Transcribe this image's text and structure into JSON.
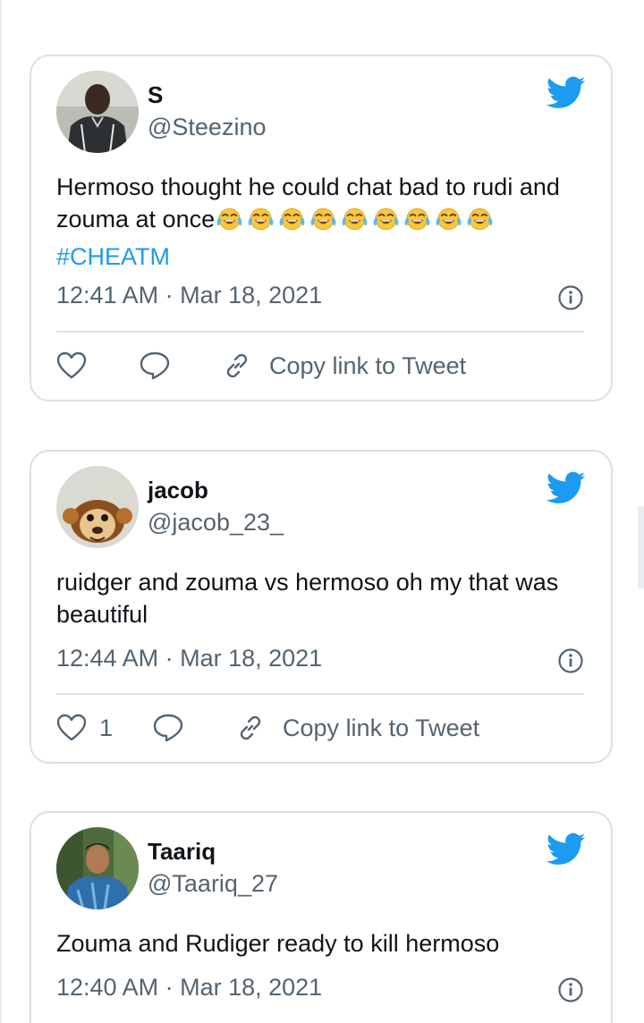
{
  "colors": {
    "brand_blue": "#1d9bf0",
    "text_primary": "#0f1419",
    "text_secondary": "#536471",
    "border": "#d9e1e7"
  },
  "icons": {
    "brand": "twitter-bird-icon",
    "info": "info-icon",
    "like": "heart-icon",
    "reply": "reply-bubble-icon",
    "copy": "link-icon",
    "emoji": "tears-of-joy-emoji"
  },
  "tweets": [
    {
      "name": "S",
      "handle": "@Steezino",
      "text_line1": "Hermoso thought he could chat bad to rudi and",
      "text_line2": "zouma at once",
      "emoji_count": 9,
      "hashtag": "#CHEATM",
      "timestamp": "12:41 AM · Mar 18, 2021",
      "like_count": "",
      "copy_label": "Copy link to Tweet"
    },
    {
      "name": "jacob",
      "handle": "@jacob_23_",
      "text": "ruidger and zouma vs hermoso oh my that was beautiful",
      "timestamp": "12:44 AM · Mar 18, 2021",
      "like_count": "1",
      "copy_label": "Copy link to Tweet"
    },
    {
      "name": "Taariq",
      "handle": "@Taariq_27",
      "text": "Zouma and Rudiger ready to kill hermoso",
      "timestamp": "12:40 AM · Mar 18, 2021"
    }
  ]
}
